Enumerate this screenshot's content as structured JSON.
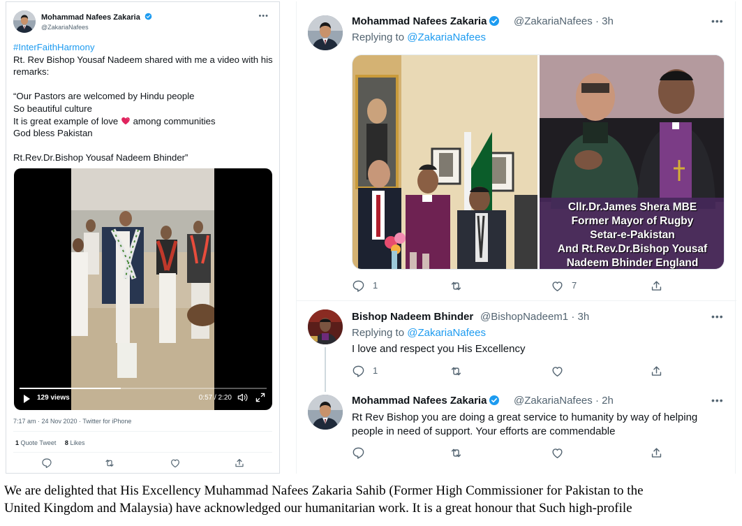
{
  "left_tweet": {
    "author_name": "Mohammad Nafees Zakaria",
    "author_handle": "@ZakariaNafees",
    "more_label": "•••",
    "hashtag": "#InterFaithHarmony",
    "text_intro": "Rt. Rev Bishop Yousaf Nadeem shared with me a video with his remarks:",
    "quote_line1": "“Our Pastors are welcomed by Hindu people",
    "quote_line2": "So beautiful culture",
    "quote_line3_before": "It is great example of love ",
    "quote_line3_after": " among communities",
    "quote_line4": "God bless Pakistan",
    "signature": "Rt.Rev.Dr.Bishop Yousaf Nadeem Bhinder”",
    "video": {
      "views": "129 views",
      "time": "0:57 / 2:20",
      "progress": 0.41
    },
    "meta": "7:17 am · 24 Nov 2020 · Twitter for iPhone",
    "stats": {
      "quote_count": "1",
      "quote_label": "Quote Tweet",
      "like_count": "8",
      "like_label": "Likes"
    }
  },
  "thread": {
    "tweet1": {
      "author_name": "Mohammad Nafees Zakaria",
      "author_handle": "@ZakariaNafees",
      "time": "· 3h",
      "replying_label": "Replying to",
      "replying_to": "@ZakariaNafees",
      "more_label": "•••",
      "caption": [
        "Cllr.Dr.James Shera MBE",
        "Former Mayor of Rugby",
        "Setar-e-Pakistan",
        "And Rt.Rev.Dr.Bishop Yousaf",
        "Nadeem Bhinder England"
      ],
      "reply_count": "1",
      "retweet_count": "",
      "like_count": "7"
    },
    "tweet2": {
      "author_name": "Bishop Nadeem Bhinder",
      "author_handle": "@BishopNadeem1",
      "time": "· 3h",
      "replying_label": "Replying to",
      "replying_to": "@ZakariaNafees",
      "more_label": "•••",
      "text": "I love and respect you His Excellency",
      "reply_count": "1",
      "retweet_count": "",
      "like_count": ""
    },
    "tweet3": {
      "author_name": "Mohammad Nafees Zakaria",
      "author_handle": "@ZakariaNafees",
      "time": "· 2h",
      "more_label": "•••",
      "text_line1": "Rt Rev Bishop you are doing a great service to humanity by way of helping",
      "text_line2": "people in need of support. Your efforts are commendable",
      "reply_count": "",
      "retweet_count": "",
      "like_count": ""
    }
  },
  "bottom_paragraph": {
    "line1": "We are delighted that His Excellency Muhammad Nafees Zakaria Sahib (Former High Commissioner for Pakistan to the",
    "line2": "United Kingdom and Malaysia) have acknowledged our humanitarian work. It is a great honour that Such high-profile"
  },
  "colors": {
    "twitter_blue": "#1d9bf0",
    "text_primary": "#0f1419",
    "text_secondary": "#536471",
    "caption_bg": "#46285a"
  },
  "icons": [
    "verified-badge-icon",
    "reply-icon",
    "retweet-icon",
    "like-icon",
    "share-icon",
    "play-icon",
    "volume-icon",
    "fullscreen-icon",
    "heart-emoji-icon"
  ]
}
